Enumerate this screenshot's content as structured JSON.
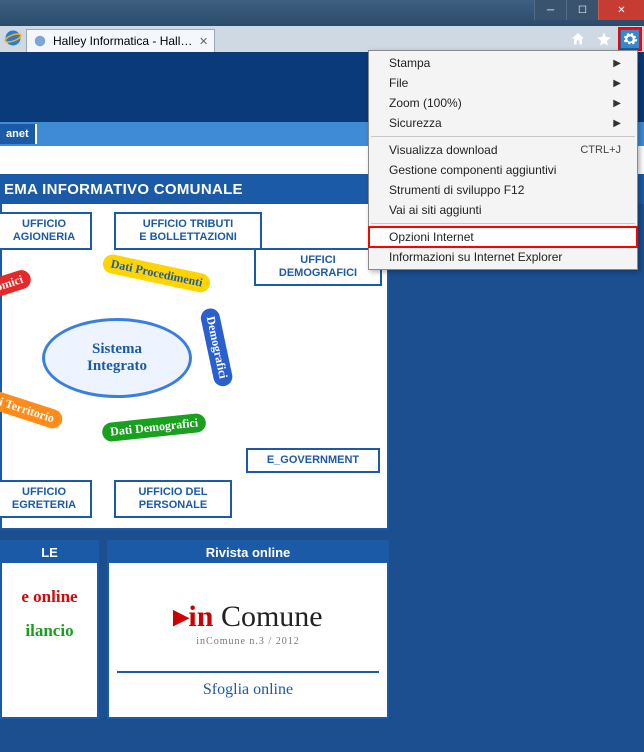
{
  "window": {
    "tab_title": "Halley Informatica - Halley ..."
  },
  "toolbar_menu": {
    "stampa": "Stampa",
    "file": "File",
    "zoom": "Zoom (100%)",
    "sicurezza": "Sicurezza",
    "visualizza_download": "Visualizza download",
    "visualizza_download_shortcut": "CTRL+J",
    "gestione_componenti": "Gestione componenti aggiuntivi",
    "strumenti_sviluppo": "Strumenti di sviluppo F12",
    "vai_siti_aggiunti": "Vai ai siti aggiunti",
    "opzioni_internet": "Opzioni Internet",
    "informazioni_ie": "Informazioni su Internet Explorer"
  },
  "page": {
    "band2_label": "anet",
    "heading": "EMA INFORMATIVO COMUNALE",
    "boxes": {
      "ragioneria_l1": "UFFICIO",
      "ragioneria_l2": "AGIONERIA",
      "tributi_l1": "UFFICIO TRIBUTI",
      "tributi_l2": "E BOLLETTAZIONI",
      "demografici_l1": "UFFICI",
      "demografici_l2": "DEMOGRAFICI",
      "egov": "E_GOVERNMENT",
      "segreteria_l1": "UFFICIO",
      "segreteria_l2": "EGRETERIA",
      "personale_l1": "UFFICIO DEL",
      "personale_l2": "PERSONALE"
    },
    "diagram": {
      "center_l1": "Sistema",
      "center_l2": "Integrato",
      "arc_red": "Economici",
      "arc_yellow": "Dati Procedimenti",
      "arc_blue": "Demografici",
      "arc_green": "Dati Demografici",
      "arc_orange": "Dati Territorio"
    },
    "panels": {
      "left_heading": "LE",
      "right_heading": "Rivista online",
      "link_online": "e online",
      "link_ilancio": "ilancio",
      "incomune_prefix": "▸",
      "incomune_text1": "in ",
      "incomune_text2": "Comune",
      "incomune_sub": "inComune n.3 / 2012",
      "sfoglia": "Sfoglia online"
    }
  }
}
